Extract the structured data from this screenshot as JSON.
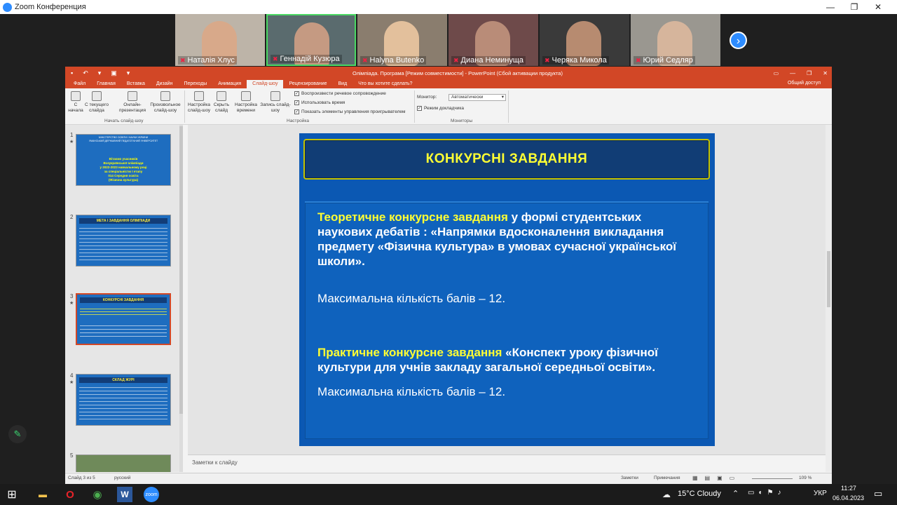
{
  "zoom": {
    "window_title": "Zoom Конференция",
    "participants": [
      {
        "name": "Наталія Хлус",
        "bg": "#bdb4a8",
        "face": "#d8a98a"
      },
      {
        "name": "Геннадій Кузюра",
        "bg": "#5a6b6e",
        "face": "#c59a82"
      },
      {
        "name": "Наlyna Butenko",
        "bg": "#8a7d6e",
        "face": "#e3c09c"
      },
      {
        "name": "Диана Неминуща",
        "bg": "#6e4a4a",
        "face": "#b98c78"
      },
      {
        "name": "Черяка Микола",
        "bg": "#3a3a3a",
        "face": "#b78b70"
      },
      {
        "name": "Юрий Седляр",
        "bg": "#9a9790",
        "face": "#d6b59c"
      }
    ],
    "next_arrow": "›"
  },
  "ppt": {
    "quick_access": [
      "▪",
      "↶",
      "▾",
      "▣",
      "▾"
    ],
    "doc_title": "Олімпіада. Програма [Режим совместимости] - PowerPoint (Сбой активации продукта)",
    "tabs": [
      "Файл",
      "Главная",
      "Вставка",
      "Дизайн",
      "Переходы",
      "Анимация",
      "Слайд-шоу",
      "Рецензирование",
      "Вид",
      "Что вы хотите сделать?"
    ],
    "share": "Общий доступ",
    "ribbon": {
      "btn_start": "С начала",
      "btn_current": "С текущего слайда",
      "btn_online": "Онлайн-презентация",
      "btn_custom": "Произвольное слайд-шоу",
      "group1": "Начать слайд-шоу",
      "btn_setup": "Настройка слайд-шоу",
      "btn_hide": "Скрыть слайд",
      "btn_timing": "Настройка времени",
      "btn_record": "Запись слайд-шоу",
      "chk1": "Воспроизвести речевое сопровождение",
      "chk2": "Использовать время",
      "chk3": "Показать элементы управления проигрывателем",
      "group2": "Настройка",
      "monitor_label": "Монитор:",
      "monitor_value": "Автоматически",
      "presenter": "Режим докладчика",
      "group3": "Мониторы"
    },
    "thumbs": {
      "t1": {
        "lines": [
          "МІНІСТЕРСТВО ОСВІТИ І НАУКИ УКРАЇНИ",
          "УМАНСЬКИЙ ДЕРЖАВНИЙ ПЕДАГОГІЧНИЙ УНІВЕРСИТЕТ",
          "Вітаємо учасників",
          "Всеукраїнської олімпіади",
          "у 2022-2023 навчальному році",
          "за спеціальністю І етапу",
          "014 Середня освіта",
          "(Фізична культура)"
        ]
      },
      "t2": {
        "title": "МЕТА І ЗАВДАННЯ ОЛІМПІАДИ"
      },
      "t3": {
        "title": "КОНКУРСНІ ЗАВДАННЯ"
      },
      "t4": {
        "title": "СКЛАД ЖУРІ"
      }
    },
    "slide": {
      "title": "КОНКУРСНІ ЗАВДАННЯ",
      "p1_yellow": "Теоретичне конкурсне завдання",
      "p1_white": " у формі студентських наукових дебатів : «Напрямки вдосконалення викладання предмету «Фізична культура» в умовах сучасної української школи».",
      "score1": "Максимальна кількість балів – 12.",
      "p2_yellow": "Практичне конкурсне завдання",
      "p2_white": " «Конспект уроку фізичної культури для учнів закладу загальної середньої освіти».",
      "score2": "Максимальна кількість балів – 12."
    },
    "notes_placeholder": "Заметки к слайду",
    "status": {
      "slide_info": "Слайд 3 из 5",
      "language": "русский",
      "notes_btn": "Заметки",
      "comments_btn": "Примечания",
      "zoom": "109 %"
    }
  },
  "taskbar": {
    "weather": "15°C  Cloudy",
    "lang": "УКР",
    "time": "11:27",
    "date": "06.04.2023"
  }
}
